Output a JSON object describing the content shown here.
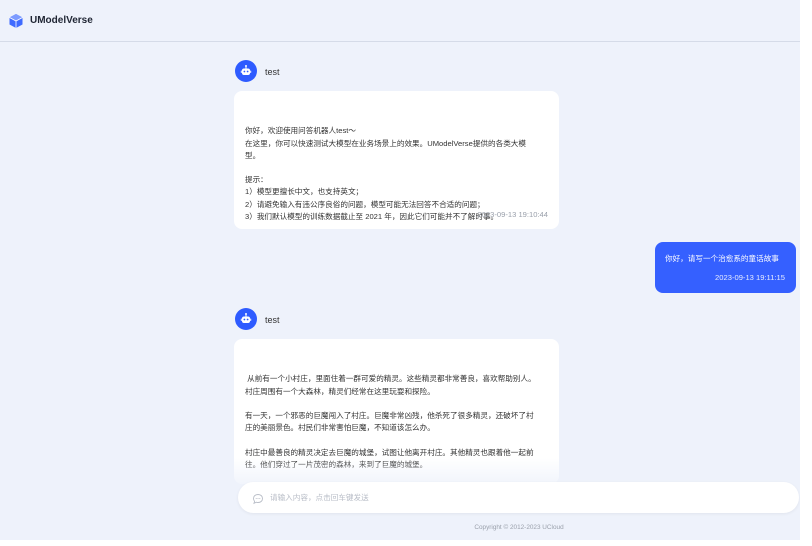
{
  "app": {
    "title": "UModelVerse"
  },
  "messages": [
    {
      "role": "bot",
      "name": "test",
      "text": "你好，欢迎使用问答机器人test～\n在这里，你可以快速测试大模型在业务场景上的效果。UModelVerse提供的各类大模\n型。\n\n提示：\n1）模型更擅长中文，也支持英文；\n2）请避免输入有违公序良俗的问题，模型可能无法回答不合适的问题；\n3）我们默认模型的训练数据截止至 2021 年，因此它们可能并不了解时事。",
      "time": "2023-09-13 19:10:44"
    },
    {
      "role": "user",
      "text": "你好，请写一个治愈系的童话故事",
      "time": "2023-09-13 19:11:15"
    },
    {
      "role": "bot",
      "name": "test",
      "text": " 从前有一个小村庄，里面住着一群可爱的精灵。这些精灵都非常善良，喜欢帮助别人。\n村庄周围有一个大森林，精灵们经常在这里玩耍和探险。\n\n有一天，一个邪恶的巨魔闯入了村庄。巨魔非常凶残，他杀死了很多精灵，还破坏了村\n庄的美丽景色。村民们非常害怕巨魔，不知道该怎么办。\n\n村庄中最善良的精灵决定去巨魔的城堡，试图让他离开村庄。其他精灵也跟着他一起前\n往。他们穿过了一片茂密的森林，来到了巨魔的城堡。\n\n在城堡里，他们发现巨魔正在用魔法控制其他精灵。为了拯救这些精灵，最善良的精灵\n决定牺牲自己，用自己的生命来换取其他精灵的自由。"
    }
  ],
  "input": {
    "placeholder": "请输入内容，点击回车键发送"
  },
  "footer": {
    "copyright": "Copyright © 2012-2023 UCloud"
  },
  "colors": {
    "accent": "#3560ff",
    "background": "#eef2fb",
    "bubble": "#ffffff"
  }
}
